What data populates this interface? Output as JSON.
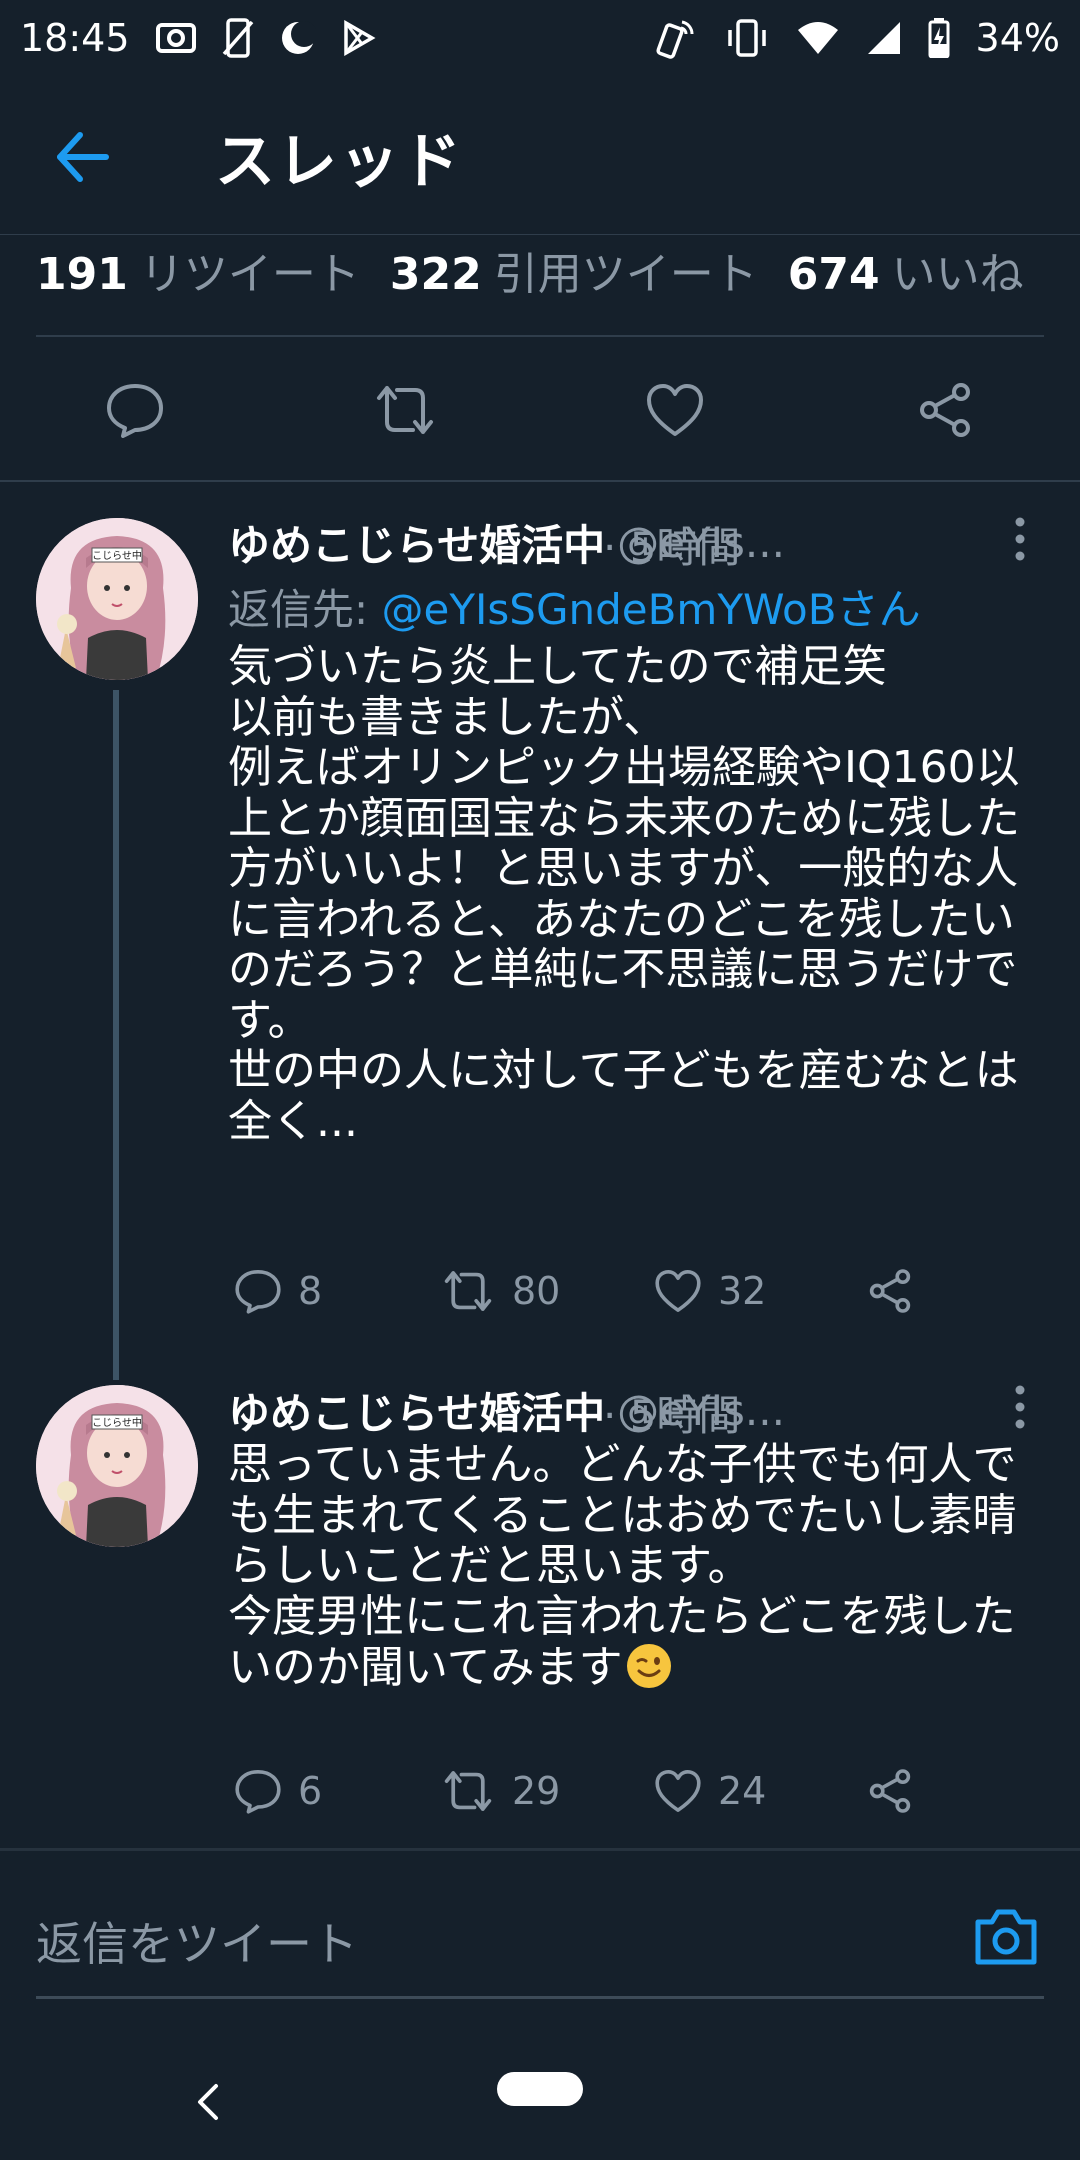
{
  "status_bar": {
    "time": "18:45",
    "battery": "34%",
    "left_icons": [
      "camera-icon",
      "no-phone-icon",
      "do-not-disturb-icon",
      "play-store-icon"
    ],
    "right_icons": [
      "nfc-icon",
      "vibrate-icon",
      "wifi-icon",
      "signal-icon",
      "battery-icon"
    ]
  },
  "header": {
    "title": "スレッド",
    "back_icon": "arrow-left-icon",
    "accent": "#1d9bf0"
  },
  "stats": {
    "retweets_count": "191",
    "retweets_label": "リツイート",
    "quotes_count": "322",
    "quotes_label": "引用ツイート",
    "likes_count": "674",
    "likes_label": "いいね"
  },
  "main_actions": [
    "reply-icon",
    "retweet-icon",
    "like-icon",
    "share-icon"
  ],
  "tweets": [
    {
      "name": "ゆめこじらせ婚活中",
      "handle": "@eYIs...",
      "time": "· 5時間",
      "reply_to_label": "返信先:",
      "reply_to_handle": "@eYIsSGndeBmYWoBさん",
      "body": "気づいたら炎上してたので補足笑\n以前も書きましたが、\n例えばオリンピック出場経験やIQ160以上とか顔面国宝なら未来のために残した方がいいよ！と思いますが、一般的な人に言われると、あなたのどこを残したいのだろう？と単純に不思議に思うだけです。\n世の中の人に対して子どもを産むなとは全く...",
      "replies": "8",
      "retweets": "80",
      "likes": "32"
    },
    {
      "name": "ゆめこじらせ婚活中",
      "handle": "@eYIs...",
      "time": "· 5時間",
      "body": "思っていません。どんな子供でも何人でも生まれてくることはおめでたいし素晴らしいことだと思います。\n今度男性にこれ言われたらどこを残したいのか聞いてみます",
      "replies": "6",
      "retweets": "29",
      "likes": "24"
    }
  ],
  "avatar_badge": "こじらせ中",
  "compose": {
    "placeholder": "返信をツイート",
    "camera_icon": "camera-icon"
  },
  "colors": {
    "background": "#15202b",
    "secondary_text": "#8b98a5",
    "divider": "#2f3d4b"
  }
}
